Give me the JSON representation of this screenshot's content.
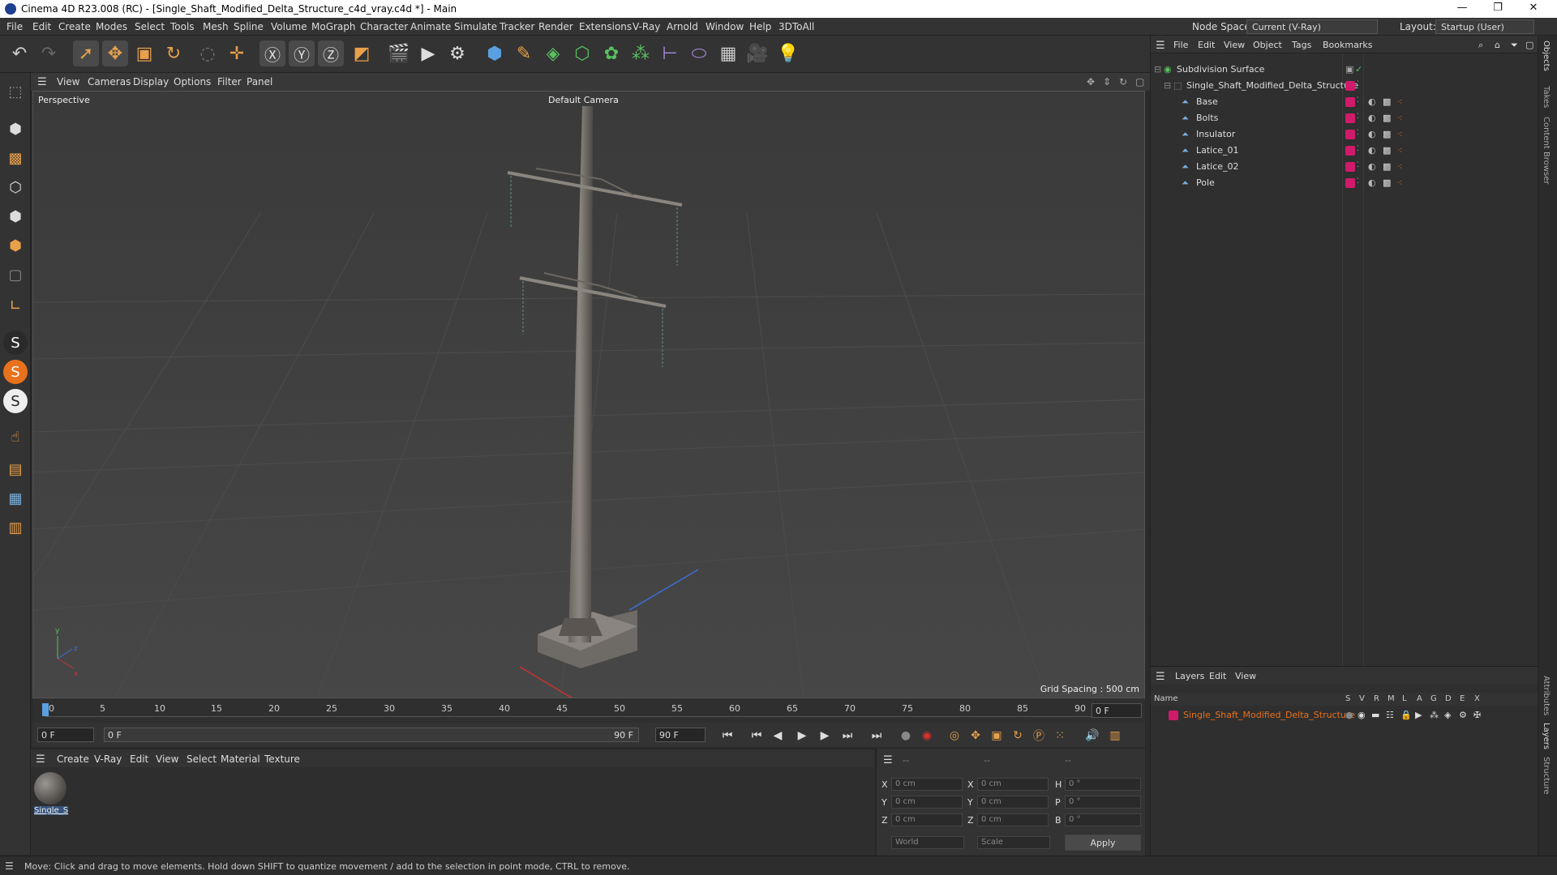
{
  "window": {
    "title": "Cinema 4D R23.008 (RC) - [Single_Shaft_Modified_Delta_Structure_c4d_vray.c4d *] - Main"
  },
  "menu": [
    "File",
    "Edit",
    "Create",
    "Modes",
    "Select",
    "Tools",
    "Mesh",
    "Spline",
    "Volume",
    "MoGraph",
    "Character",
    "Animate",
    "Simulate",
    "Tracker",
    "Render",
    "Extensions",
    "V-Ray",
    "Arnold",
    "Window",
    "Help",
    "3DToAll"
  ],
  "nodespace": {
    "label": "Node Space:",
    "value": "Current (V-Ray)"
  },
  "layout": {
    "label": "Layout:",
    "value": "Startup (User)"
  },
  "viewport": {
    "menu": [
      "View",
      "Cameras",
      "Display",
      "Options",
      "Filter",
      "Panel"
    ],
    "label": "Perspective",
    "camera": "Default Camera",
    "grid": "Grid Spacing : 500 cm"
  },
  "timeline": {
    "ticks": [
      "0",
      "5",
      "10",
      "15",
      "20",
      "25",
      "30",
      "35",
      "40",
      "45",
      "50",
      "55",
      "60",
      "65",
      "70",
      "75",
      "80",
      "85",
      "90"
    ],
    "current": "0 F",
    "start": "0 F",
    "range_start": "0 F",
    "range_end": "90 F",
    "end": "90 F"
  },
  "material": {
    "menu": [
      "Create",
      "V-Ray",
      "Edit",
      "View",
      "Select",
      "Material",
      "Texture"
    ],
    "item": "Single_S"
  },
  "coords": {
    "header": [
      "--",
      "--",
      "--"
    ],
    "x_label": "X",
    "y_label": "Y",
    "z_label": "Z",
    "h_label": "H",
    "p_label": "P",
    "b_label": "B",
    "pos": [
      "0 cm",
      "0 cm",
      "0 cm"
    ],
    "size": [
      "0 cm",
      "0 cm",
      "0 cm"
    ],
    "rot": [
      "0 °",
      "0 °",
      "0 °"
    ],
    "world": "World",
    "scale": "Scale",
    "apply": "Apply"
  },
  "objects": {
    "menu": [
      "File",
      "Edit",
      "View",
      "Object",
      "Tags",
      "Bookmarks"
    ],
    "root": "Subdivision Surface",
    "group": "Single_Shaft_Modified_Delta_Structure",
    "children": [
      "Base",
      "Bolts",
      "Insulator",
      "Latice_01",
      "Latice_02",
      "Pole"
    ]
  },
  "layers": {
    "menu": [
      "Layers",
      "Edit",
      "View"
    ],
    "name_header": "Name",
    "cols": [
      "S",
      "V",
      "R",
      "M",
      "L",
      "A",
      "G",
      "D",
      "E",
      "X"
    ],
    "item": "Single_Shaft_Modified_Delta_Structure"
  },
  "sidetabs": [
    "Objects",
    "Takes",
    "Content Browser",
    "Attributes",
    "Layers",
    "Structure"
  ],
  "status": "Move: Click and drag to move elements. Hold down SHIFT to quantize movement / add to the selection in point mode, CTRL to remove.",
  "colors": {
    "accent": "#e8711c",
    "layer": "#d01a6a"
  }
}
